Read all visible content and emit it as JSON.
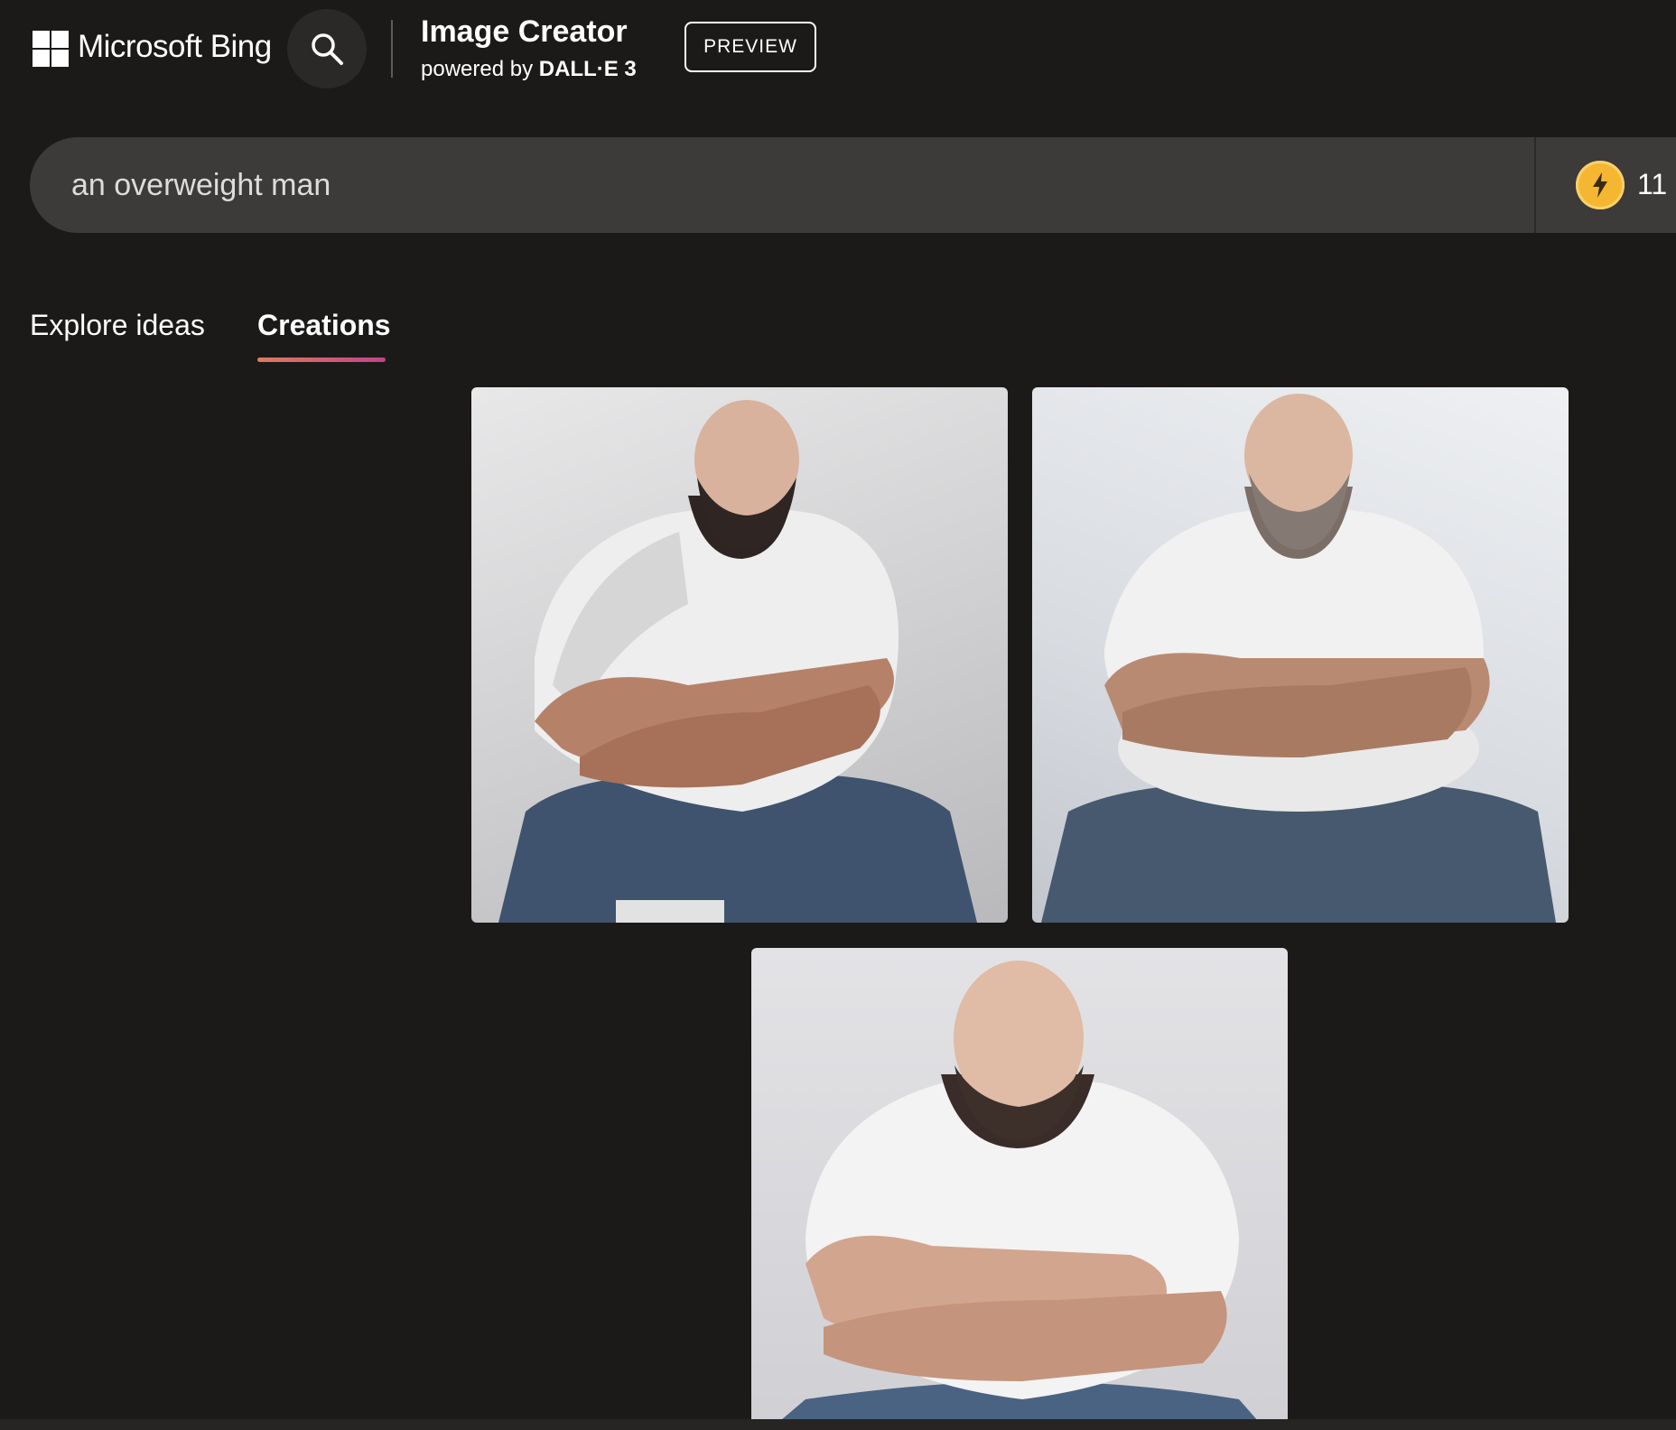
{
  "header": {
    "brand": "Microsoft Bing",
    "product_title": "Image Creator",
    "powered_by": "powered by",
    "model_name": "DALL·E 3",
    "preview_label": "PREVIEW"
  },
  "prompt": {
    "value": "an overweight man",
    "boosts_count": "11"
  },
  "tabs": [
    {
      "label": "Explore ideas",
      "active": false
    },
    {
      "label": "Creations",
      "active": true
    }
  ],
  "creations": [
    {
      "alt": "generated image 1",
      "description_icon": "image-thumbnail"
    },
    {
      "alt": "generated image 2",
      "description_icon": "image-thumbnail"
    },
    {
      "alt": "generated image 3",
      "description_icon": "image-thumbnail"
    }
  ],
  "colors": {
    "background": "#1b1a19",
    "prompt_bar": "#3c3b3a",
    "boost_coin": "#f5b731",
    "tab_underline_start": "#e07b5a",
    "tab_underline_end": "#c2428a"
  }
}
